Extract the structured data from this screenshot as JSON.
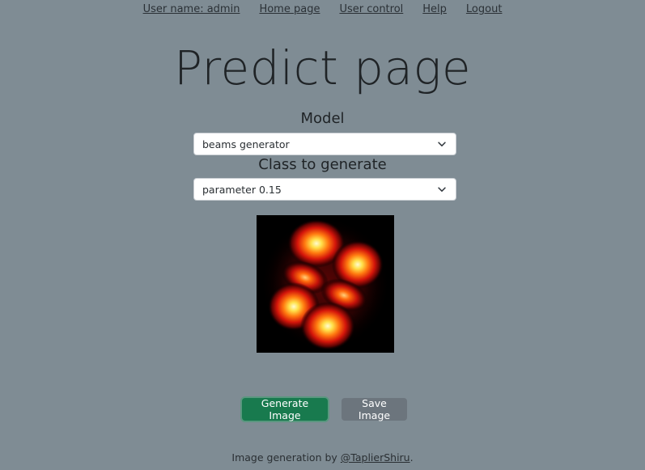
{
  "nav": {
    "user": "User name: admin",
    "home": "Home page",
    "user_control": "User control",
    "help": "Help",
    "logout": "Logout"
  },
  "title": "Predict page",
  "model": {
    "label": "Model",
    "value": "beams generator"
  },
  "class_select": {
    "label": "Class to generate",
    "value": "parameter 0.15"
  },
  "buttons": {
    "generate": "Generate Image",
    "save": "Save Image"
  },
  "footer": {
    "text": "Image generation by ",
    "link": "@TaplierShiru",
    "suffix": "."
  },
  "colors": {
    "background": "#7f8c94",
    "primary": "#187a4e",
    "secondary": "#6c757d"
  }
}
